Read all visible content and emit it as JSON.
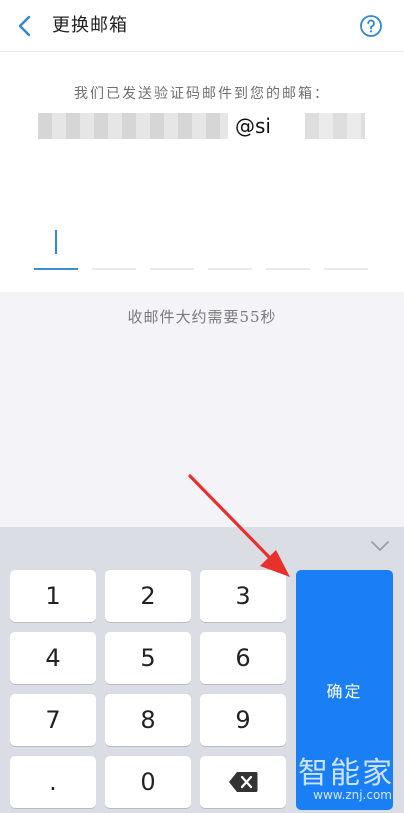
{
  "header": {
    "title": "更换邮箱",
    "back_icon": "chevron-left-icon",
    "help_icon": "question-circle-icon",
    "accent_color": "#2f86d6"
  },
  "verify": {
    "prompt": "我们已发送验证码邮件到您的邮箱：",
    "email_visible": "@si",
    "code_length": 6
  },
  "countdown": {
    "text": "收邮件大约需要55秒"
  },
  "keyboard": {
    "keys": [
      "1",
      "2",
      "3",
      "4",
      "5",
      "6",
      "7",
      "8",
      "9",
      ".",
      "0"
    ],
    "backspace_icon": "backspace-icon",
    "confirm_label": "确定",
    "confirm_color": "#1a7ff5",
    "collapse_icon": "chevron-down-icon"
  },
  "watermark": {
    "cn": "智能家",
    "url": "www.znj.com"
  }
}
